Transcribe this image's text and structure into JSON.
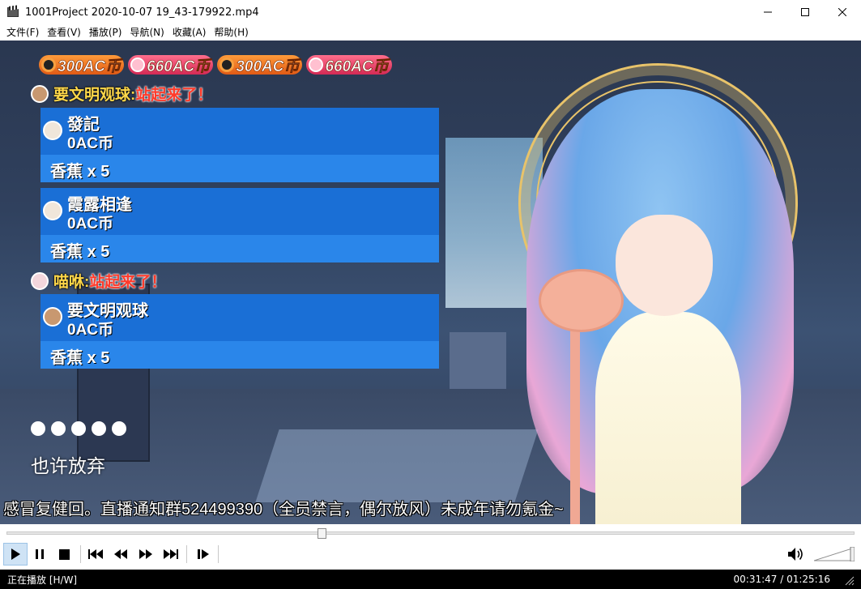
{
  "window": {
    "title": "1001Project 2020-10-07 19_43-179922.mp4"
  },
  "menu": {
    "items": [
      "文件(F)",
      "查看(V)",
      "播放(P)",
      "导航(N)",
      "收藏(A)",
      "帮助(H)"
    ]
  },
  "overlay": {
    "gifts": [
      {
        "text": "300AC币",
        "kind": "ac"
      },
      {
        "text": "660AC币",
        "kind": "pink"
      },
      {
        "text": "300AC币",
        "kind": "ac"
      },
      {
        "text": "660AC币",
        "kind": "pink"
      }
    ],
    "joins": [
      {
        "name": "要文明观球:",
        "msg": "站起来了！"
      },
      {
        "name": "喵咻:",
        "msg": "站起来了！"
      }
    ],
    "cards": [
      {
        "name": "發記",
        "coin": "0AC币",
        "gift": "香蕉 x 5"
      },
      {
        "name": "霞露相逢",
        "coin": "0AC币",
        "gift": "香蕉 x 5"
      },
      {
        "name": "要文明观球",
        "coin": "0AC币",
        "gift": "香蕉 x 5"
      }
    ],
    "dot_count": 5,
    "subtitle": "也许放弃",
    "ticker": "感冒复健回。直播通知群524499390（全员禁言，偶尔放风）未成年请勿氪金~"
  },
  "player": {
    "seek_position": 0.3716,
    "volume": 1.0
  },
  "status": {
    "state": "正在播放 [H/W]",
    "time": "00:31:47 / 01:25:16"
  }
}
